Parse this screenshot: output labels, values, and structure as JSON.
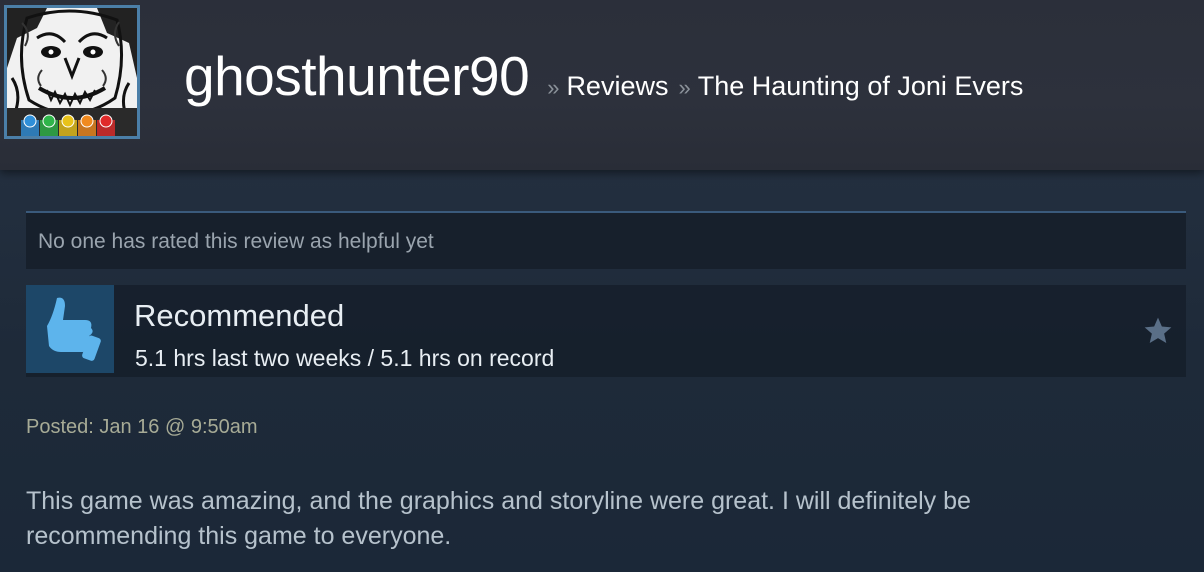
{
  "header": {
    "username": "ghosthunter90",
    "separator": "»",
    "breadcrumbs": [
      "Reviews",
      "The Haunting of Joni Evers"
    ]
  },
  "avatar": {
    "icon": "monster-face-avatar",
    "badge_dots": [
      "#2f8fd8",
      "#2fb54a",
      "#e8c21a",
      "#f08a1e",
      "#e02a2a"
    ]
  },
  "review": {
    "helpful_text": "No one has rated this review as helpful yet",
    "verdict": "Recommended",
    "verdict_icon": "thumbs-up-icon",
    "hours": "5.1 hrs last two weeks / 5.1 hrs on record",
    "award_icon": "star-icon",
    "posted": "Posted: Jan 16 @ 9:50am",
    "body": "This game was amazing, and the graphics and storyline were great. I will definitely be recommending this game to everyone."
  },
  "colors": {
    "background": "#1b2838",
    "header": "#2d313c",
    "thumb_bg": "#1d4768",
    "thumb_icon": "#5db4ec",
    "posted_text": "#a7ab96"
  }
}
